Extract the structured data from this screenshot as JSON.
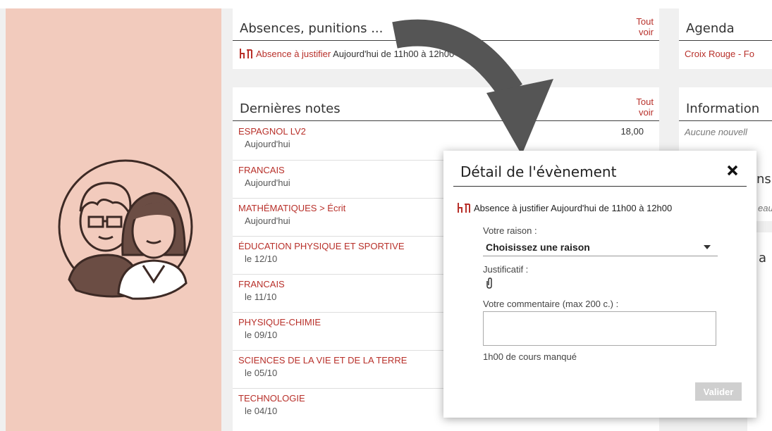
{
  "absences": {
    "title": "Absences, punitions ...",
    "see_all": "Tout voir",
    "item_label": "Absence à justifier",
    "item_time": "Aujourd'hui de 11h00 à 12h00"
  },
  "notes": {
    "title": "Dernières notes",
    "see_all": "Tout voir",
    "items": [
      {
        "subject": "ESPAGNOL LV2",
        "date": "Aujourd'hui",
        "grade": "18,00"
      },
      {
        "subject": "FRANCAIS",
        "date": "Aujourd'hui",
        "grade": ""
      },
      {
        "subject": "MATHÉMATIQUES > Écrit",
        "date": "Aujourd'hui",
        "grade": ""
      },
      {
        "subject": "ÉDUCATION PHYSIQUE ET SPORTIVE",
        "date": "le 12/10",
        "grade": ""
      },
      {
        "subject": "FRANCAIS",
        "date": "le 11/10",
        "grade": ""
      },
      {
        "subject": "PHYSIQUE-CHIMIE",
        "date": "le 09/10",
        "grade": ""
      },
      {
        "subject": "SCIENCES DE LA VIE ET DE LA TERRE",
        "date": "le 05/10",
        "grade": ""
      },
      {
        "subject": "TECHNOLOGIE",
        "date": "le 04/10",
        "grade": ""
      }
    ]
  },
  "agenda": {
    "title": "Agenda",
    "item": "Croix Rouge - Fo"
  },
  "informations": {
    "title": "Information",
    "empty": "Aucune nouvell"
  },
  "partial": {
    "title_1": "ns",
    "text_1": "eau",
    "title_2": "a"
  },
  "modal": {
    "title": "Détail de l'évènement",
    "event_text": "Absence à justifier Aujourd'hui de 11h00 à 12h00",
    "reason_label": "Votre raison :",
    "reason_value": "Choisissez une raison",
    "proof_label": "Justificatif :",
    "comment_label": "Votre commentaire (max 200 c.) :",
    "missed": "1h00 de cours manqué",
    "validate": "Valider"
  },
  "colors": {
    "accent": "#b8302a",
    "left_panel": "#f2cbbd",
    "arrow": "#555555"
  }
}
